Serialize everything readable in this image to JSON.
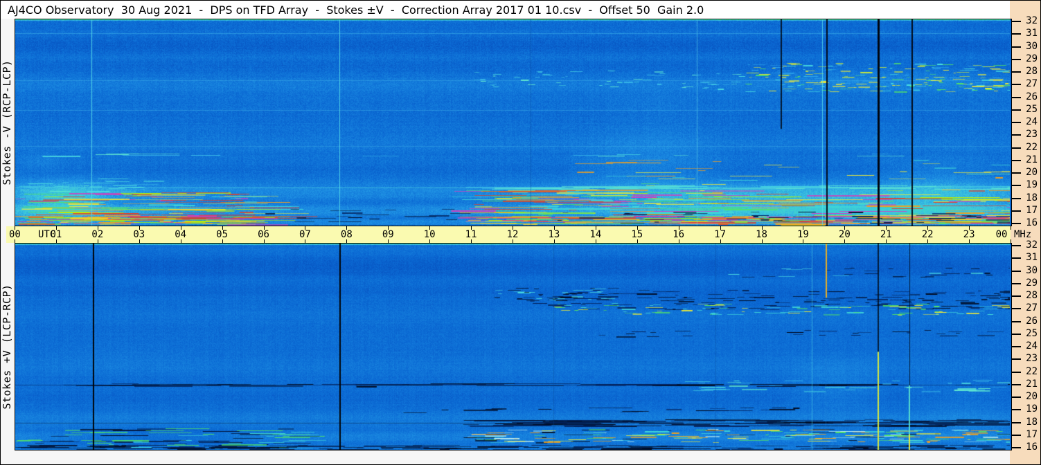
{
  "window": {
    "title": "AJ4CO Observatory  30 Aug 2021  -  DPS on TFD Array  -  Stokes ±V  -  Correction Array 2017 01 10.csv  -  Offset 50  Gain 2.0"
  },
  "time_axis": {
    "start_label": "00",
    "utc_label": "UTC",
    "end_label": "00",
    "mhz_label": "MHz",
    "hour_labels": [
      "01",
      "02",
      "03",
      "04",
      "05",
      "06",
      "07",
      "08",
      "09",
      "10",
      "11",
      "12",
      "13",
      "14",
      "15",
      "16",
      "17",
      "18",
      "19",
      "20",
      "21",
      "22",
      "23"
    ]
  },
  "freq_axis": {
    "labels": [
      "32",
      "31",
      "30",
      "29",
      "28",
      "27",
      "26",
      "25",
      "24",
      "23",
      "22",
      "21",
      "20",
      "19",
      "18",
      "17",
      "16"
    ]
  },
  "chart_data": {
    "type": "heatmap",
    "title": "AJ4CO Observatory 30 Aug 2021 - DPS on TFD Array - Stokes ±V - Correction Array 2017 01 10.csv - Offset 50 Gain 2.0",
    "x": {
      "label": "UTC",
      "range": [
        0,
        24
      ],
      "unit": "hours",
      "tick_step": 1
    },
    "y": {
      "label": "MHz",
      "range": [
        16,
        32
      ],
      "unit": "MHz",
      "orientation": "32 at top, 16 at bottom",
      "tick_step": 1
    },
    "annotations": [
      {
        "time_utc": "01:53",
        "desc": "bright cyan vertical line in top panel; black dropout line in bottom panel"
      },
      {
        "time_utc": "07:50",
        "desc": "bright cyan vertical line in top panel; black dropout line in bottom panel"
      },
      {
        "time_utc": "16:27",
        "desc": "faint cyan vertical line, top panel"
      },
      {
        "time_utc": "19:30",
        "desc": "cyan + black vertical lines top panel; yellow-orange flare 28-32 MHz bottom panel"
      },
      {
        "time_utc": "20:50",
        "desc": "strong black vertical line top panel; bright yellow-green line 16-23.5 MHz bottom panel"
      },
      {
        "time_utc": "21:35",
        "desc": "black vertical line top panel; cyan/yellow line 16-21 MHz bottom panel"
      },
      {
        "band": "16-18.5 MHz",
        "desc": "dense shortwave-station interference streaks (yellow/orange/red/green), strongest 00-06 and 11-24 UTC"
      },
      {
        "band": "26.5-28.5 MHz",
        "desc": "speckle interference band after ~17:30 UTC (top) and dark speckles after ~12:00 UTC (bottom)"
      }
    ],
    "render": {
      "top_row_boost": 0.3,
      "colormap": [
        [
          0.0,
          "#000814"
        ],
        [
          0.1,
          "#01206c"
        ],
        [
          0.22,
          "#0545b4"
        ],
        [
          0.34,
          "#0b6ad4"
        ],
        [
          0.46,
          "#1f92e4"
        ],
        [
          0.56,
          "#3cc3e0"
        ],
        [
          0.64,
          "#40dfc0"
        ],
        [
          0.72,
          "#52e464"
        ],
        [
          0.8,
          "#c8e83c"
        ],
        [
          0.87,
          "#f0b028"
        ],
        [
          0.94,
          "#f05818"
        ],
        [
          1.0,
          "#e82888"
        ]
      ],
      "palettes": {
        "bright": [
          "#e8e83c",
          "#f0a020",
          "#e04028",
          "#d040c0",
          "#50e070",
          "#40d8d8",
          "#c0f000"
        ],
        "hot": [
          "#f0a020",
          "#e8d030",
          "#e04828",
          "#d040a0",
          "#80e040"
        ],
        "hotc": [
          "#f0a020",
          "#e8e83c",
          "#40d8d8"
        ],
        "cyan2": [
          "#48d8e0",
          "#60e8d0",
          "#38b8e8"
        ],
        "speck": [
          "#49e0e0",
          "#52e464",
          "#c8e83c",
          "#2fa8ec",
          "#e8e83c"
        ],
        "mixg": [
          "#40d8d8",
          "#52e464",
          "#e8e83c"
        ],
        "mixb": [
          "#40d8d8",
          "#c0f0f0",
          "#52e464",
          "#e8e83c",
          "#000a20",
          "#f0a020"
        ],
        "mixd": [
          "#021840",
          "#40d8d8",
          "#52e464",
          "#000a20"
        ],
        "mixd2": [
          "#021840",
          "#48d8e0",
          "#000a20"
        ],
        "darkst": [
          "#000a20",
          "#021840",
          "#03225c"
        ]
      }
    },
    "panels": [
      {
        "id": "top",
        "label": "Stokes -V (RCP-LCP)",
        "seed": 12345,
        "base": 0.365,
        "noise": 0.08,
        "gauss": [
          17.4,
          1.4,
          0.11
        ],
        "lowboost": [
          [
            0,
            1
          ],
          [
            1.6,
            0.95
          ],
          [
            5,
            0.3
          ],
          [
            10.5,
            0.22
          ],
          [
            13,
            0.55
          ],
          [
            18,
            0.85
          ],
          [
            24,
            1
          ]
        ],
        "bands": [
          [
            30.9,
            32,
            -0.02
          ],
          [
            29.1,
            30.9,
            -0.05
          ],
          [
            27.7,
            29.0,
            -0.03
          ],
          [
            26.2,
            27.6,
            0.03
          ],
          [
            23.8,
            25.1,
            -0.015
          ],
          [
            21.6,
            23.1,
            0.02
          ],
          [
            19.7,
            20.9,
            -0.02
          ],
          [
            17.9,
            19.5,
            0.05
          ],
          [
            16.6,
            17.7,
            0.07
          ],
          [
            16.0,
            16.55,
            0.05
          ]
        ],
        "blobs": [
          [
            0,
            2.4,
            16.1,
            20,
            0.1
          ],
          [
            0,
            1.3,
            20,
            21.8,
            0.04
          ],
          [
            13.2,
            17.3,
            17.4,
            23.8,
            0.05
          ],
          [
            13.4,
            24,
            16,
            19.6,
            0.07
          ],
          [
            20.6,
            24,
            16,
            21.8,
            0.05
          ],
          [
            17.5,
            24,
            26.2,
            28.8,
            0.035
          ],
          [
            6,
            11,
            16.2,
            18.4,
            -0.025
          ],
          [
            14,
            16.8,
            21,
            27.5,
            0.02
          ]
        ],
        "hlines": [
          [
            0,
            24,
            30.95,
            "#5ad2f0",
            0.35
          ],
          [
            0,
            24,
            27.3,
            "#5ad2f0",
            0.3
          ],
          [
            0,
            24,
            24.95,
            "#5ad2f0",
            0.3
          ],
          [
            0,
            24,
            22.2,
            "#5ad2f0",
            0.25
          ],
          [
            0,
            24,
            18.95,
            "#55e0e0",
            0.5
          ]
        ],
        "streaks": [
          [
            0,
            5.8,
            16.1,
            18.6,
            150,
            8,
            110,
            "bright"
          ],
          [
            0,
            3.2,
            18.6,
            19.7,
            30,
            6,
            45,
            "cyan2"
          ],
          [
            10.5,
            24,
            16.1,
            18.8,
            240,
            8,
            130,
            "bright"
          ],
          [
            10.5,
            24,
            16.15,
            16.75,
            140,
            15,
            90,
            "hot"
          ],
          [
            0,
            5.8,
            16.15,
            16.75,
            70,
            10,
            60,
            "hot"
          ],
          [
            13,
            24,
            19.4,
            21.3,
            30,
            10,
            80,
            "hotc"
          ],
          [
            17.5,
            24,
            26.4,
            28.6,
            210,
            3,
            20,
            "speck"
          ],
          [
            11,
            17.5,
            26.6,
            28.1,
            60,
            3,
            14,
            "cyan2"
          ],
          [
            12,
            16.6,
            17.4,
            19.3,
            45,
            6,
            55,
            "mixg"
          ],
          [
            10.8,
            24,
            18.85,
            19.1,
            40,
            40,
            170,
            "cyan2"
          ],
          [
            6,
            10.5,
            16.3,
            17.3,
            18,
            8,
            50,
            "darkst"
          ],
          [
            13,
            24,
            16.2,
            17.1,
            50,
            6,
            40,
            "darkst"
          ],
          [
            0,
            24,
            21.4,
            21.6,
            14,
            20,
            90,
            "cyan2"
          ]
        ],
        "vlines": [
          [
            1.85,
            16,
            32,
            "#55dce8",
            1,
            0.9
          ],
          [
            7.83,
            16,
            32,
            "#55dce8",
            1,
            0.85
          ],
          [
            12.44,
            16,
            32,
            "#074a9c",
            1,
            0.45
          ],
          [
            16.45,
            16,
            32,
            "#66e2ea",
            1,
            0.5
          ],
          [
            18.48,
            23.5,
            32,
            "#000814",
            2,
            0.85
          ],
          [
            19.48,
            16,
            32,
            "#5ae0e8",
            1,
            0.75
          ],
          [
            19.58,
            16,
            32,
            "#000814",
            2,
            0.95
          ],
          [
            20.83,
            16,
            32,
            "#000610",
            3,
            1
          ],
          [
            21.64,
            16,
            32,
            "#000814",
            2,
            0.95
          ]
        ]
      },
      {
        "id": "bottom",
        "label": "Stokes +V (LCP-RCP)",
        "seed": 67890,
        "base": 0.352,
        "noise": 0.065,
        "gauss": [
          17.2,
          1.2,
          0.05
        ],
        "lowboost": [
          [
            0,
            0.55
          ],
          [
            5,
            0.3
          ],
          [
            11,
            0.3
          ],
          [
            18,
            0.5
          ],
          [
            24,
            0.6
          ]
        ],
        "bands": [
          [
            29.2,
            31.2,
            -0.045
          ],
          [
            27.8,
            28.9,
            -0.02
          ],
          [
            25.6,
            27.3,
            0.015
          ],
          [
            21.4,
            23.6,
            0.02
          ],
          [
            19.4,
            20.6,
            -0.015
          ],
          [
            17.7,
            19.1,
            0.03
          ],
          [
            16.5,
            17.5,
            0.04
          ],
          [
            16.0,
            16.45,
            0.02
          ]
        ],
        "blobs": [
          [
            0,
            6.6,
            16,
            17.9,
            -0.05
          ],
          [
            0,
            24,
            31.1,
            32,
            0.015
          ],
          [
            18.4,
            21.2,
            18.3,
            23.8,
            0.04
          ],
          [
            21.6,
            24,
            16.4,
            21.5,
            0.025
          ],
          [
            11,
            24,
            26.7,
            28.5,
            -0.02
          ],
          [
            0,
            5,
            21.5,
            24.5,
            0.015
          ]
        ],
        "hlines": [
          [
            0,
            24,
            21.05,
            "#03225c",
            0.5
          ],
          [
            0,
            24,
            18.1,
            "#021130",
            0.45
          ]
        ],
        "streaks": [
          [
            10.8,
            24,
            17.85,
            18.35,
            110,
            10,
            120,
            "darkst"
          ],
          [
            10.8,
            24,
            16.6,
            17.6,
            170,
            4,
            45,
            "mixb"
          ],
          [
            0,
            7,
            16.1,
            17.7,
            80,
            6,
            70,
            "mixd"
          ],
          [
            0,
            24,
            16.05,
            16.4,
            130,
            10,
            80,
            "darkst"
          ],
          [
            12,
            24,
            26.9,
            28.4,
            160,
            4,
            30,
            "darkst"
          ],
          [
            13,
            24,
            26.5,
            27.4,
            90,
            4,
            26,
            "mixg"
          ],
          [
            0,
            24,
            20.95,
            21.15,
            40,
            20,
            150,
            "darkst"
          ],
          [
            16,
            24,
            20.5,
            21.4,
            35,
            6,
            45,
            "cyan2"
          ],
          [
            9,
            20,
            18.9,
            19.3,
            20,
            8,
            60,
            "darkst"
          ],
          [
            14,
            24,
            24.8,
            25.3,
            25,
            5,
            30,
            "darkst"
          ],
          [
            17,
            24,
            29.3,
            30.2,
            30,
            4,
            25,
            "mixd2"
          ],
          [
            11.5,
            14.5,
            27.6,
            28.6,
            40,
            4,
            20,
            "mixd2"
          ]
        ],
        "vlines": [
          [
            1.886,
            16,
            32,
            "#000408",
            2,
            1
          ],
          [
            7.844,
            16,
            32,
            "#000408",
            2,
            1
          ],
          [
            13.0,
            16,
            32,
            "#07458f",
            1,
            0.35
          ],
          [
            16.9,
            16,
            32,
            "#074a9c",
            1,
            0.4
          ],
          [
            19.23,
            16,
            32,
            "#4cd4e4",
            1,
            0.55
          ],
          [
            19.57,
            27.8,
            32,
            "#f2b21e",
            2,
            0.95
          ],
          [
            19.57,
            16,
            27.8,
            "#2c90dc",
            1,
            0.3
          ],
          [
            20.82,
            23.6,
            32,
            "#000814",
            2,
            0.8
          ],
          [
            20.82,
            16,
            23.6,
            "#dcec3a",
            2,
            0.95
          ],
          [
            21.58,
            21,
            32,
            "#000814",
            1,
            0.8
          ],
          [
            21.58,
            16,
            21,
            "#5ce4cc",
            2,
            0.9
          ],
          [
            21.58,
            16,
            17.2,
            "#eaea3a",
            2,
            0.95
          ]
        ]
      }
    ]
  }
}
